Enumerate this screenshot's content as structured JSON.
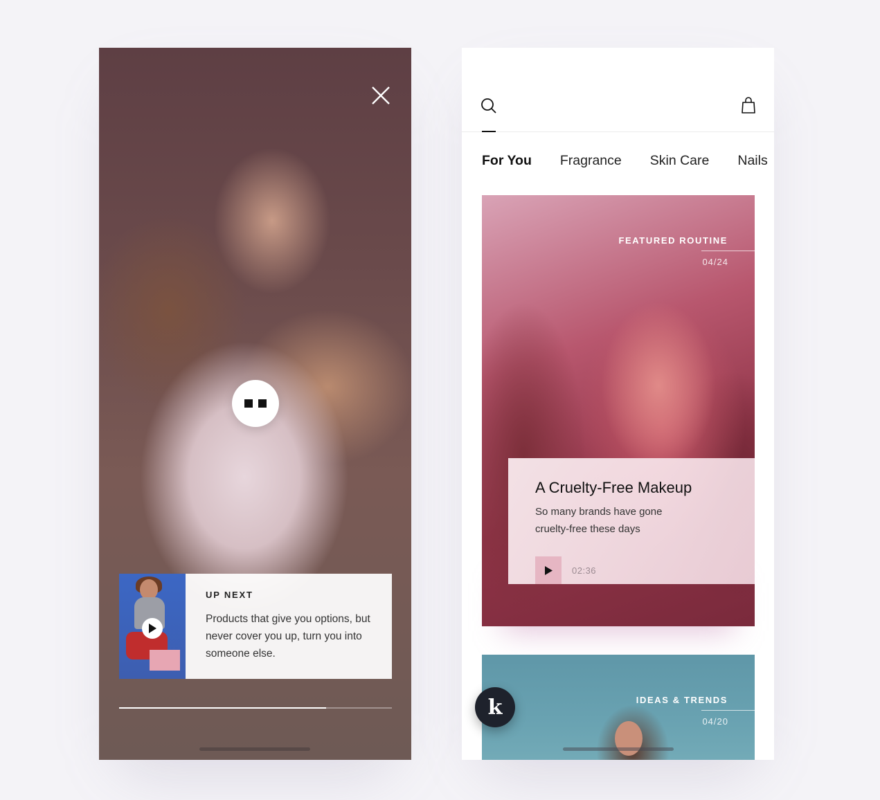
{
  "player": {
    "up_next": {
      "heading": "UP NEXT",
      "description": "Products that give you options, but never cover you up, turn you into someone else."
    },
    "progress": 0.76,
    "icons": {
      "close": "close-icon",
      "pause": "pause-icon",
      "play": "play-icon"
    }
  },
  "feed": {
    "icons": {
      "search": "search-icon",
      "bag": "shopping-bag-icon",
      "logo": "brand-logo-icon"
    },
    "tabs": [
      {
        "label": "For You",
        "active": true
      },
      {
        "label": "Fragrance",
        "active": false
      },
      {
        "label": "Skin Care",
        "active": false
      },
      {
        "label": "Nails",
        "active": false
      }
    ],
    "featured_card": {
      "category": "FEATURED ROUTINE",
      "date": "04/24",
      "title": "A Cruelty-Free Makeup",
      "description": "So many brands have gone cruelty-free these days",
      "duration": "02:36"
    },
    "second_card": {
      "category": "IDEAS & TRENDS",
      "date": "04/20"
    },
    "fab_logo_text": "k"
  },
  "colors": {
    "background": "#f4f3f7",
    "fab": "#1e222c",
    "text_dark": "#111111",
    "accent_pink": "#e6b6c3"
  }
}
